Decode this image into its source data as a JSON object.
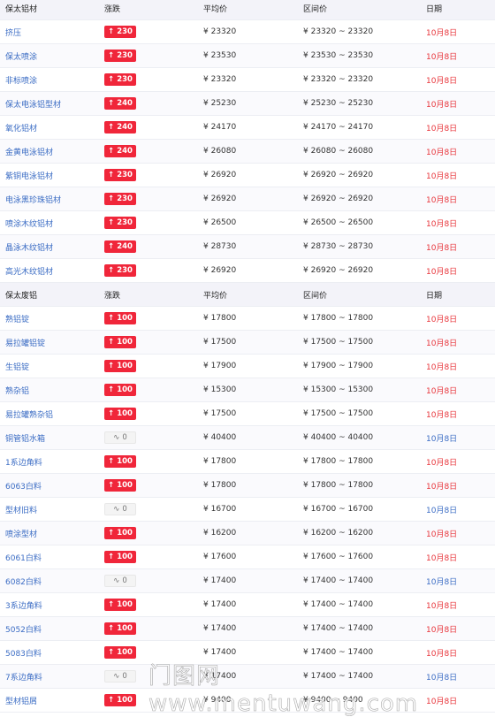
{
  "sections": [
    {
      "header": {
        "name": "保太铝材",
        "change": "涨跌",
        "avg": "平均价",
        "range": "区间价",
        "date": "日期"
      },
      "rows": [
        {
          "name": "挤压",
          "change": "230",
          "dir": "up",
          "avg": "¥ 23320",
          "range": "¥ 23320 ~ 23320",
          "date": "10月8日",
          "dateColor": "red"
        },
        {
          "name": "保太喷涂",
          "change": "230",
          "dir": "up",
          "avg": "¥ 23530",
          "range": "¥ 23530 ~ 23530",
          "date": "10月8日",
          "dateColor": "red"
        },
        {
          "name": "非标喷涂",
          "change": "230",
          "dir": "up",
          "avg": "¥ 23320",
          "range": "¥ 23320 ~ 23320",
          "date": "10月8日",
          "dateColor": "red"
        },
        {
          "name": "保太电泳铝型材",
          "change": "240",
          "dir": "up",
          "avg": "¥ 25230",
          "range": "¥ 25230 ~ 25230",
          "date": "10月8日",
          "dateColor": "red"
        },
        {
          "name": "氧化铝材",
          "change": "240",
          "dir": "up",
          "avg": "¥ 24170",
          "range": "¥ 24170 ~ 24170",
          "date": "10月8日",
          "dateColor": "red"
        },
        {
          "name": "金黄电泳铝材",
          "change": "240",
          "dir": "up",
          "avg": "¥ 26080",
          "range": "¥ 26080 ~ 26080",
          "date": "10月8日",
          "dateColor": "red"
        },
        {
          "name": "紫铜电泳铝材",
          "change": "230",
          "dir": "up",
          "avg": "¥ 26920",
          "range": "¥ 26920 ~ 26920",
          "date": "10月8日",
          "dateColor": "red"
        },
        {
          "name": "电泳黑珍珠铝材",
          "change": "230",
          "dir": "up",
          "avg": "¥ 26920",
          "range": "¥ 26920 ~ 26920",
          "date": "10月8日",
          "dateColor": "red"
        },
        {
          "name": "喷涂木纹铝材",
          "change": "230",
          "dir": "up",
          "avg": "¥ 26500",
          "range": "¥ 26500 ~ 26500",
          "date": "10月8日",
          "dateColor": "red"
        },
        {
          "name": "晶泳木纹铝材",
          "change": "240",
          "dir": "up",
          "avg": "¥ 28730",
          "range": "¥ 28730 ~ 28730",
          "date": "10月8日",
          "dateColor": "red"
        },
        {
          "name": "高光木纹铝材",
          "change": "230",
          "dir": "up",
          "avg": "¥ 26920",
          "range": "¥ 26920 ~ 26920",
          "date": "10月8日",
          "dateColor": "red"
        }
      ]
    },
    {
      "header": {
        "name": "保太废铝",
        "change": "涨跌",
        "avg": "平均价",
        "range": "区间价",
        "date": "日期"
      },
      "rows": [
        {
          "name": "熟铝锭",
          "change": "100",
          "dir": "up",
          "avg": "¥ 17800",
          "range": "¥ 17800 ~ 17800",
          "date": "10月8日",
          "dateColor": "red"
        },
        {
          "name": "易拉罐铝锭",
          "change": "100",
          "dir": "up",
          "avg": "¥ 17500",
          "range": "¥ 17500 ~ 17500",
          "date": "10月8日",
          "dateColor": "red"
        },
        {
          "name": "生铝锭",
          "change": "100",
          "dir": "up",
          "avg": "¥ 17900",
          "range": "¥ 17900 ~ 17900",
          "date": "10月8日",
          "dateColor": "red"
        },
        {
          "name": "熟杂铝",
          "change": "100",
          "dir": "up",
          "avg": "¥ 15300",
          "range": "¥ 15300 ~ 15300",
          "date": "10月8日",
          "dateColor": "red"
        },
        {
          "name": "易拉罐熟杂铝",
          "change": "100",
          "dir": "up",
          "avg": "¥ 17500",
          "range": "¥ 17500 ~ 17500",
          "date": "10月8日",
          "dateColor": "red"
        },
        {
          "name": "铜管铝水箱",
          "change": "0",
          "dir": "flat",
          "avg": "¥ 40400",
          "range": "¥ 40400 ~ 40400",
          "date": "10月8日",
          "dateColor": "blue"
        },
        {
          "name": "1系边角料",
          "change": "100",
          "dir": "up",
          "avg": "¥ 17800",
          "range": "¥ 17800 ~ 17800",
          "date": "10月8日",
          "dateColor": "red"
        },
        {
          "name": "6063白料",
          "change": "100",
          "dir": "up",
          "avg": "¥ 17800",
          "range": "¥ 17800 ~ 17800",
          "date": "10月8日",
          "dateColor": "red"
        },
        {
          "name": "型材旧料",
          "change": "0",
          "dir": "flat",
          "avg": "¥ 16700",
          "range": "¥ 16700 ~ 16700",
          "date": "10月8日",
          "dateColor": "blue"
        },
        {
          "name": "喷涂型材",
          "change": "100",
          "dir": "up",
          "avg": "¥ 16200",
          "range": "¥ 16200 ~ 16200",
          "date": "10月8日",
          "dateColor": "red"
        },
        {
          "name": "6061白料",
          "change": "100",
          "dir": "up",
          "avg": "¥ 17600",
          "range": "¥ 17600 ~ 17600",
          "date": "10月8日",
          "dateColor": "red"
        },
        {
          "name": "6082白料",
          "change": "0",
          "dir": "flat",
          "avg": "¥ 17400",
          "range": "¥ 17400 ~ 17400",
          "date": "10月8日",
          "dateColor": "blue"
        },
        {
          "name": "3系边角料",
          "change": "100",
          "dir": "up",
          "avg": "¥ 17400",
          "range": "¥ 17400 ~ 17400",
          "date": "10月8日",
          "dateColor": "red"
        },
        {
          "name": "5052白料",
          "change": "100",
          "dir": "up",
          "avg": "¥ 17400",
          "range": "¥ 17400 ~ 17400",
          "date": "10月8日",
          "dateColor": "red"
        },
        {
          "name": "5083白料",
          "change": "100",
          "dir": "up",
          "avg": "¥ 17400",
          "range": "¥ 17400 ~ 17400",
          "date": "10月8日",
          "dateColor": "red"
        },
        {
          "name": "7系边角料",
          "change": "0",
          "dir": "flat",
          "avg": "¥ 17400",
          "range": "¥ 17400 ~ 17400",
          "date": "10月8日",
          "dateColor": "blue"
        },
        {
          "name": "型材铝屑",
          "change": "100",
          "dir": "up",
          "avg": "¥ 9400",
          "range": "¥ 9400 ~ 9400",
          "date": "10月8日",
          "dateColor": "red"
        }
      ]
    }
  ],
  "icons": {
    "up": "arrow-up-icon",
    "flat": "flat-wave-icon"
  },
  "colors": {
    "up_badge": "#f0263a",
    "date_red": "#e8343a",
    "date_blue": "#3b6cc4",
    "name_link": "#3b6cc4",
    "header_bg": "#f3f3f9"
  },
  "watermark": "门图网 www.mentuwang.com"
}
